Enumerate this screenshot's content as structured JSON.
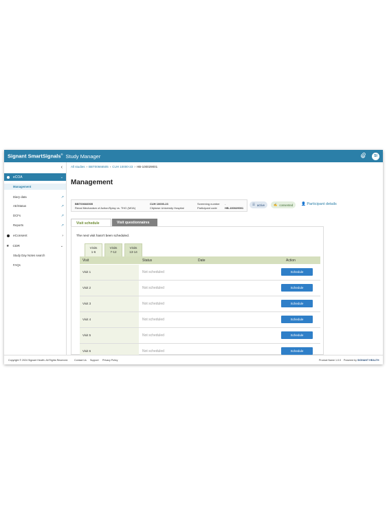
{
  "header": {
    "brand": "Signant SmartSignals",
    "brand_mark": "®",
    "app_name": "Study Manager",
    "avatar": "SI",
    "icons": [
      "paperclip-icon",
      "chevron-left-icon"
    ]
  },
  "sidebar": {
    "ecoa_label": "eCOA",
    "ecoa_items": [
      {
        "label": "Management",
        "active": true
      },
      {
        "label": "Diary data",
        "external": true
      },
      {
        "label": "AE/Status",
        "external": true
      },
      {
        "label": "DCFs",
        "external": true
      },
      {
        "label": "Reports",
        "external": true
      }
    ],
    "econsent_label": "eConsent",
    "cdr_label": "CDR",
    "cdr_items": [
      {
        "label": "Study Day Notes search"
      },
      {
        "label": "FAQs"
      }
    ]
  },
  "breadcrumb": {
    "all_studies": "All studies",
    "study": "BBT00666505",
    "site": "CUH 10000-23",
    "participant": "HB-100029001"
  },
  "page": {
    "title": "Management"
  },
  "info": {
    "study_code": "BBT00666505",
    "study_name": "Renal Mechanism of Action/Splay vs. THG (MOA)",
    "site_code": "CUH 10000-23",
    "site_name": "Citytown University Hospital",
    "screening_label": "Screening number",
    "screening_value": "-",
    "participant_label": "Participant code",
    "participant_value": "HB-100029001",
    "status_badge": "active",
    "consent_badge": "consented",
    "participant_details": "Participant details"
  },
  "tabs": {
    "visit_schedule": "Visit schedule",
    "visit_questionnaires": "Visit questionnaires"
  },
  "schedule": {
    "notice": "The next visit hasn't been scheduled.",
    "visit_tabs": [
      {
        "line1": "Visits",
        "line2": "1-6"
      },
      {
        "line1": "Visits",
        "line2": "7-12"
      },
      {
        "line1": "Visits",
        "line2": "13-14"
      }
    ],
    "columns": {
      "visit": "Visit",
      "status": "Status",
      "date": "Date",
      "action": "Action"
    },
    "rows": [
      {
        "visit": "Visit 1",
        "status": "Not scheduled",
        "action": "Schedule"
      },
      {
        "visit": "Visit 2",
        "status": "Not scheduled",
        "action": "Schedule"
      },
      {
        "visit": "Visit 3",
        "status": "Not scheduled",
        "action": "Schedule"
      },
      {
        "visit": "Visit 4",
        "status": "Not scheduled",
        "action": "Schedule"
      },
      {
        "visit": "Visit 5",
        "status": "Not scheduled",
        "action": "Schedule"
      },
      {
        "visit": "Visit 6",
        "status": "Not scheduled",
        "action": "Schedule"
      }
    ]
  },
  "footer": {
    "copyright": "Copyright © 2024 Signant Health. All Rights Reserved.",
    "contact": "Contact Us",
    "support": "Support",
    "privacy": "Privacy Policy",
    "product": "Product Name 1.0.0",
    "powered": "Powered by",
    "vendor": "SIGNANT HEALTH"
  },
  "colors": {
    "accent": "#2b7fa8",
    "button": "#2f7fc8",
    "table_header": "#d5dfbd"
  }
}
